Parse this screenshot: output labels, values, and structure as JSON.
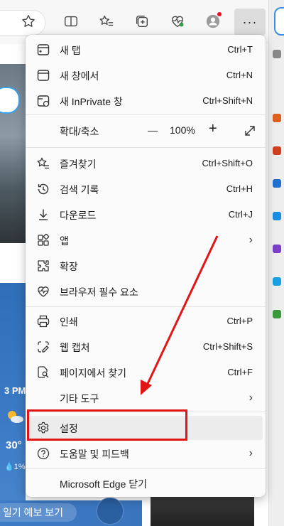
{
  "toolbar": {
    "icons": [
      "star-outline-icon",
      "split-screen-icon",
      "favorites-icon",
      "collections-icon",
      "browser-essentials-icon",
      "profile-icon"
    ],
    "more_label": "···"
  },
  "background": {
    "weather_time": "3 PM",
    "weather_temp": "30°",
    "weather_precip": "💧1%",
    "forecast_button": "일기 예보 보기"
  },
  "menu": {
    "items": [
      {
        "icon": "new-tab-icon",
        "label": "새 탭",
        "shortcut": "Ctrl+T"
      },
      {
        "icon": "new-window-icon",
        "label": "새 창에서",
        "shortcut": "Ctrl+N"
      },
      {
        "icon": "inprivate-window-icon",
        "label": "새 InPrivate 창",
        "shortcut": "Ctrl+Shift+N"
      },
      {
        "icon": "favorites-icon",
        "label": "즐겨찾기",
        "shortcut": "Ctrl+Shift+O"
      },
      {
        "icon": "history-icon",
        "label": "검색 기록",
        "shortcut": "Ctrl+H"
      },
      {
        "icon": "download-icon",
        "label": "다운로드",
        "shortcut": "Ctrl+J"
      },
      {
        "icon": "apps-icon",
        "label": "앱",
        "shortcut": ""
      },
      {
        "icon": "extensions-icon",
        "label": "확장",
        "shortcut": ""
      },
      {
        "icon": "browser-essentials-icon",
        "label": "브라우저 필수 요소",
        "shortcut": ""
      },
      {
        "icon": "print-icon",
        "label": "인쇄",
        "shortcut": "Ctrl+P"
      },
      {
        "icon": "web-capture-icon",
        "label": "웹 캡처",
        "shortcut": "Ctrl+Shift+S"
      },
      {
        "icon": "find-on-page-icon",
        "label": "페이지에서 찾기",
        "shortcut": "Ctrl+F"
      },
      {
        "icon": "",
        "label": "기타 도구",
        "shortcut": ""
      },
      {
        "icon": "settings-icon",
        "label": "설정",
        "shortcut": ""
      },
      {
        "icon": "help-icon",
        "label": "도움말 및 피드백",
        "shortcut": ""
      },
      {
        "icon": "",
        "label": "Microsoft Edge 닫기",
        "shortcut": ""
      }
    ],
    "zoom": {
      "label": "확대/축소",
      "minus": "—",
      "value": "100%",
      "plus": "+"
    },
    "chevron": "›"
  },
  "annotation": {
    "highlight_color": "#e11515"
  }
}
